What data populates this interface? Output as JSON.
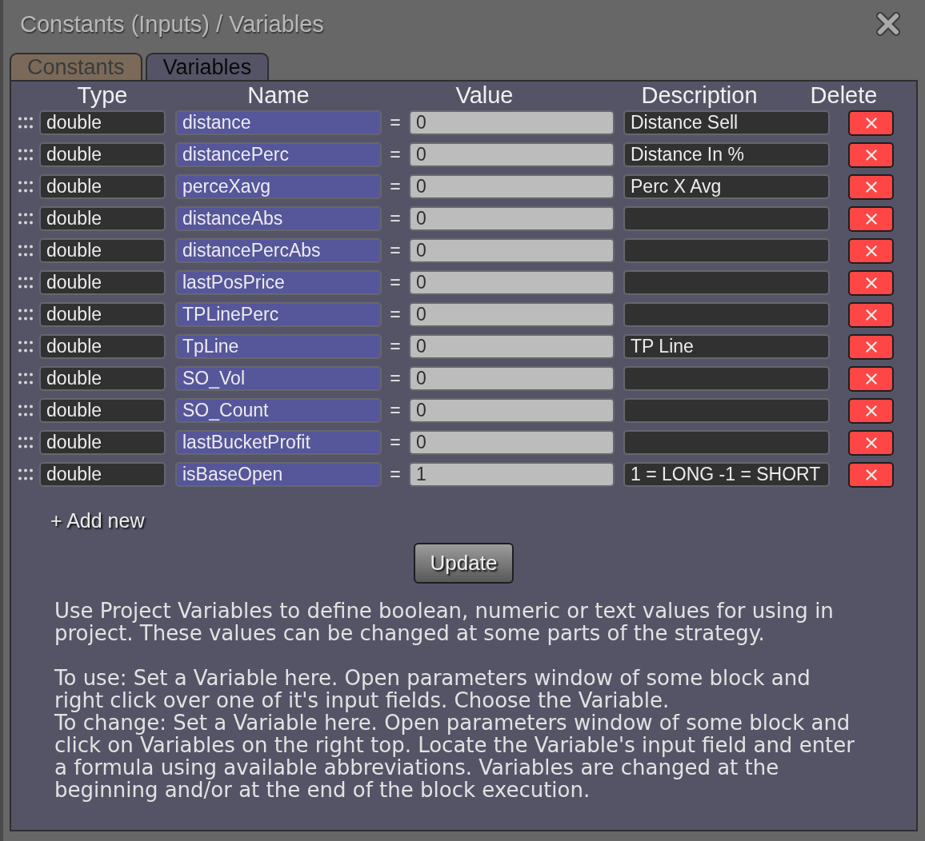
{
  "window": {
    "title": "Constants (Inputs) / Variables"
  },
  "tabs": [
    {
      "label": "Constants",
      "selected": false
    },
    {
      "label": "Variables",
      "selected": true
    }
  ],
  "table": {
    "columns": [
      "Type",
      "Name",
      "Value",
      "Description",
      "Delete"
    ],
    "rows": [
      {
        "type": "double",
        "name": "distance",
        "operator": "=",
        "value": "0",
        "description": "Distance Sell"
      },
      {
        "type": "double",
        "name": "distancePerc",
        "operator": "=",
        "value": "0",
        "description": "Distance In %"
      },
      {
        "type": "double",
        "name": "perceXavg",
        "operator": "=",
        "value": "0",
        "description": "Perc X Avg"
      },
      {
        "type": "double",
        "name": "distanceAbs",
        "operator": "=",
        "value": "0"
      },
      {
        "type": "double",
        "name": "distancePercAbs",
        "operator": "=",
        "value": "0"
      },
      {
        "type": "double",
        "name": "lastPosPrice",
        "operator": "=",
        "value": "0"
      },
      {
        "type": "double",
        "name": "TPLinePerc",
        "operator": "=",
        "value": "0"
      },
      {
        "type": "double",
        "name": "TpLine",
        "operator": "=",
        "value": "0",
        "description": "TP Line"
      },
      {
        "type": "double",
        "name": "SO_Vol",
        "operator": "=",
        "value": "0"
      },
      {
        "type": "double",
        "name": "SO_Count",
        "operator": "=",
        "value": "0"
      },
      {
        "type": "double",
        "name": "lastBucketProfit",
        "operator": "=",
        "value": "0"
      },
      {
        "type": "double",
        "name": "isBaseOpen",
        "operator": "=",
        "value": "1",
        "description": "1 = LONG -1 = SHORT"
      }
    ]
  },
  "add_new": "+ Add new",
  "update_button": "Update",
  "help": {
    "sections": [
      [
        "Use Project Variables to define boolean, numeric or text values for using in project. These values can be changed at some parts of the strategy."
      ],
      [
        "To use: Set a Variable here. Open parameters window of some block and right click over one of it's input fields. Choose the Variable.",
        "To change: Set a Variable here. Open parameters window of some block and click on Variables on the right top. Locate the Variable's input field and enter a formula using available abbreviations. Variables are changed at the beginning and/or at the end of the block execution."
      ]
    ]
  }
}
